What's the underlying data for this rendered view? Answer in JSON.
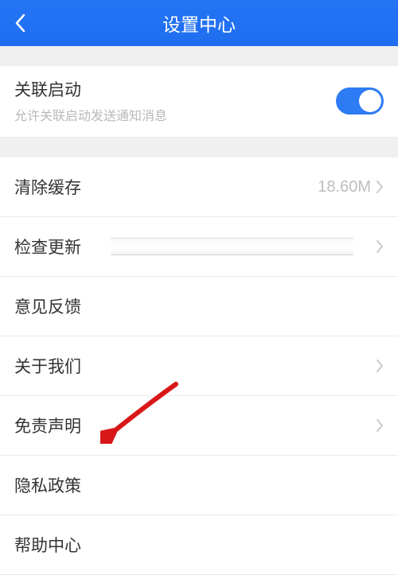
{
  "header": {
    "title": "设置中心"
  },
  "toggle": {
    "title": "关联启动",
    "subtitle": "允许关联启动发送通知消息"
  },
  "items": {
    "clearCache": {
      "title": "清除缓存",
      "value": "18.60M"
    },
    "checkUpdate": {
      "title": "检查更新"
    },
    "feedback": {
      "title": "意见反馈"
    },
    "aboutUs": {
      "title": "关于我们"
    },
    "disclaimer": {
      "title": "免责声明"
    },
    "privacy": {
      "title": "隐私政策"
    },
    "help": {
      "title": "帮助中心"
    }
  }
}
